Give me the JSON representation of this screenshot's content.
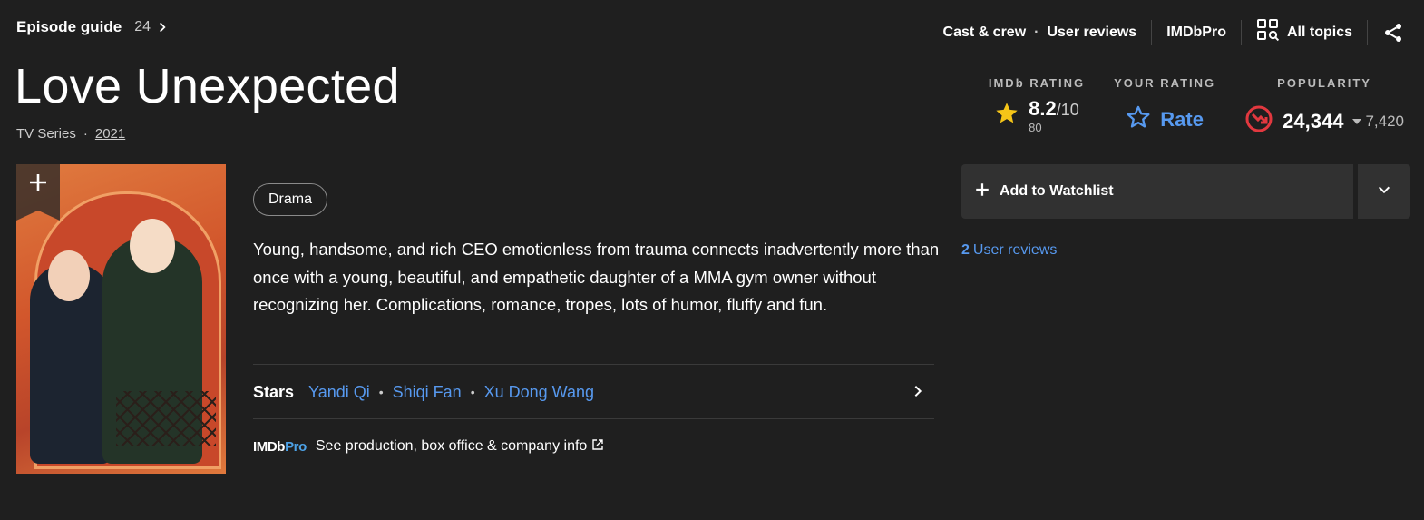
{
  "topbar": {
    "episode_guide_label": "Episode guide",
    "episode_count": "24",
    "nav": {
      "cast_crew": "Cast & crew",
      "user_reviews": "User reviews",
      "imdbpro": "IMDbPro",
      "all_topics": "All topics"
    }
  },
  "title": "Love Unexpected",
  "meta": {
    "type": "TV Series",
    "year": "2021"
  },
  "ratings": {
    "imdb": {
      "label": "IMDb RATING",
      "score": "8.2",
      "out_of": "/10",
      "votes": "80"
    },
    "yours": {
      "label": "YOUR RATING",
      "action": "Rate"
    },
    "popularity": {
      "label": "POPULARITY",
      "rank": "24,344",
      "delta": "7,420"
    }
  },
  "genre": "Drama",
  "plot": "Young, handsome, and rich CEO emotionless from trauma connects inadvertently more than once with a young, beautiful, and empathetic daughter of a MMA gym owner without recognizing her. Complications, romance, tropes, lots of humor, fluffy and fun.",
  "stars": {
    "label": "Stars",
    "names": [
      "Yandi Qi",
      "Shiqi Fan",
      "Xu Dong Wang"
    ]
  },
  "imdbpro_link": {
    "logo_a": "IMDb",
    "logo_b": "Pro",
    "text": "See production, box office & company info"
  },
  "watchlist": {
    "label": "Add to Watchlist"
  },
  "user_reviews": {
    "count": "2",
    "label": "User reviews"
  },
  "colors": {
    "accent_blue": "#5799ef",
    "star_yellow": "#f5c518",
    "popularity_red": "#e2383f",
    "background": "#1f1f1f"
  },
  "icons": [
    "chevron-right-icon",
    "grid-icon",
    "share-icon",
    "star-icon",
    "star-outline-icon",
    "trend-down-icon",
    "caret-down-icon",
    "plus-icon",
    "chevron-down-icon",
    "external-link-icon"
  ]
}
